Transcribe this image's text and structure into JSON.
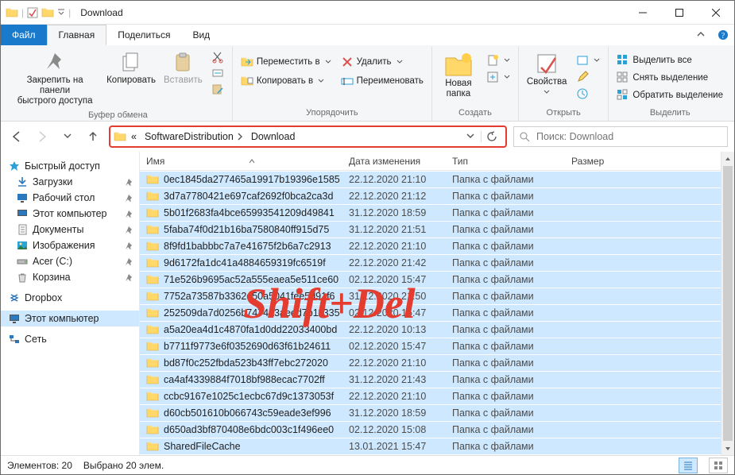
{
  "window": {
    "title": "Download"
  },
  "tabs": {
    "file": "Файл",
    "home": "Главная",
    "share": "Поделиться",
    "view": "Вид"
  },
  "ribbon": {
    "pin": "Закрепить на панели\nбыстрого доступа",
    "copy": "Копировать",
    "paste": "Вставить",
    "clipboard_label": "Буфер обмена",
    "move_to": "Переместить в",
    "copy_to": "Копировать в",
    "delete": "Удалить",
    "rename": "Переименовать",
    "organize_label": "Упорядочить",
    "new_folder": "Новая\nпапка",
    "create_label": "Создать",
    "properties": "Свойства",
    "open_label": "Открыть",
    "select_all": "Выделить все",
    "select_none": "Снять выделение",
    "invert_selection": "Обратить выделение",
    "select_label": "Выделить"
  },
  "address": {
    "crumb_prefix": "«",
    "crumb1": "SoftwareDistribution",
    "crumb2": "Download"
  },
  "search": {
    "placeholder": "Поиск: Download"
  },
  "sidebar": {
    "quick_access": "Быстрый доступ",
    "downloads": "Загрузки",
    "desktop": "Рабочий стол",
    "this_pc_qa": "Этот компьютер",
    "documents": "Документы",
    "pictures": "Изображения",
    "acer_c": "Acer (C:)",
    "recycle": "Корзина",
    "dropbox": "Dropbox",
    "this_pc": "Этот компьютер",
    "network": "Сеть"
  },
  "columns": {
    "name": "Имя",
    "date": "Дата изменения",
    "type": "Тип",
    "size": "Размер"
  },
  "file_type": "Папка с файлами",
  "rows": [
    {
      "name": "0ec1845da277465a19917b19396e1585",
      "date": "22.12.2020 21:10"
    },
    {
      "name": "3d7a7780421e697caf2692f0bca2ca3d",
      "date": "22.12.2020 21:12"
    },
    {
      "name": "5b01f2683fa4bce65993541209d49841",
      "date": "31.12.2020 18:59"
    },
    {
      "name": "5faba74f0d21b16ba7580840ff915d75",
      "date": "31.12.2020 21:51"
    },
    {
      "name": "8f9fd1babbbc7a7e41675f2b6a7c2913",
      "date": "22.12.2020 21:10"
    },
    {
      "name": "9d6172fa1dc41a4884659319fc6519f",
      "date": "22.12.2020 21:42"
    },
    {
      "name": "71e526b9695ac52a555eaea5e511ce60",
      "date": "02.12.2020 15:47"
    },
    {
      "name": "7752a73587b3362d50a5041fee5d91f6",
      "date": "31.12.2020 21:50"
    },
    {
      "name": "252509da7d0256b7474a3aeed7b11335",
      "date": "02.12.2020 15:47"
    },
    {
      "name": "a5a20ea4d1c4870fa1d0dd22033400bd",
      "date": "22.12.2020 10:13"
    },
    {
      "name": "b7711f9773e6f0352690d63f61b24611",
      "date": "02.12.2020 15:47"
    },
    {
      "name": "bd87f0c252fbda523b43ff7ebc272020",
      "date": "22.12.2020 21:10"
    },
    {
      "name": "ca4af4339884f7018bf988ecac7702ff",
      "date": "31.12.2020 21:43"
    },
    {
      "name": "ccbc9167e1025c1ecbc67d9c1373053f",
      "date": "22.12.2020 21:10"
    },
    {
      "name": "d60cb501610b066743c59eade3ef996",
      "date": "31.12.2020 18:59"
    },
    {
      "name": "d650ad3bf870408e6bdc003c1f496ee0",
      "date": "02.12.2020 15:08"
    },
    {
      "name": "SharedFileCache",
      "date": "13.01.2021 15:47"
    }
  ],
  "status": {
    "count": "Элементов: 20",
    "selected": "Выбрано 20 элем."
  },
  "overlay": "Shift+Del"
}
